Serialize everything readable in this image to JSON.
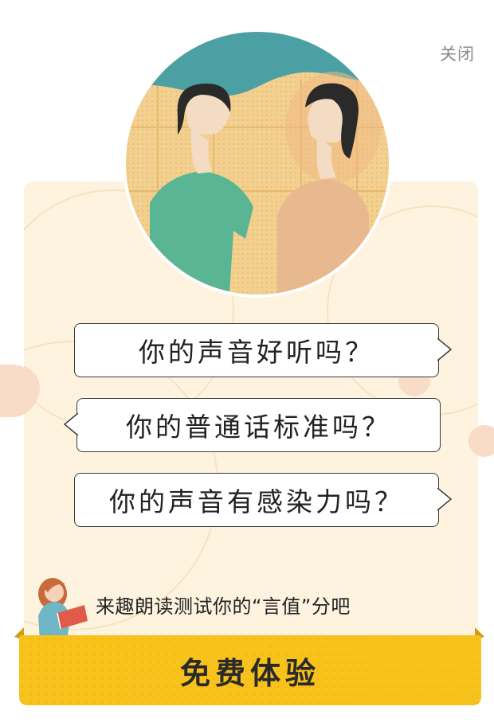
{
  "header": {
    "close_label": "关闭"
  },
  "questions": [
    {
      "text": "你的声音好听吗？"
    },
    {
      "text": "你的普通话标准吗？"
    },
    {
      "text": "你的声音有感染力吗？"
    }
  ],
  "tagline": "来趣朗读测试你的“言值”分吧",
  "cta": {
    "label": "免费体验"
  },
  "icons": {
    "hero": "two-women-conversation-illustration",
    "mascot": "girl-reading-book-icon"
  },
  "colors": {
    "card_bg": "#fdf3df",
    "cta_bg": "#f8c21d",
    "bubble_border": "#3a3a3a",
    "close_text": "#8a8a8a"
  }
}
